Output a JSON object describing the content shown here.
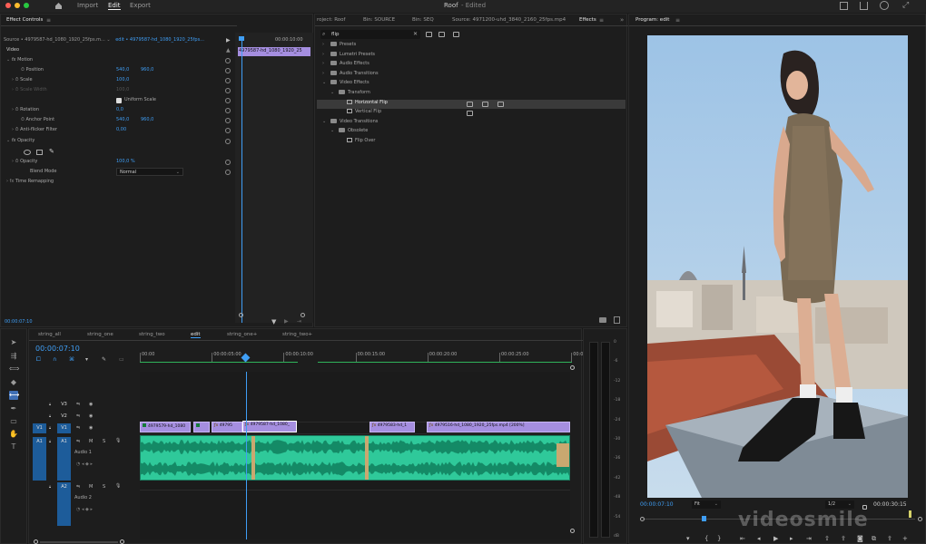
{
  "window": {
    "title": "Roof",
    "subtitle": "- Edited",
    "menu": [
      "Import",
      "Edit",
      "Export"
    ],
    "active_menu": "Edit"
  },
  "effect_controls": {
    "tab": "Effect Controls",
    "source": "Source • 4979587-hd_1080_1920_25fps.m...",
    "sequence": "edit • 4979587-hd_1080_1920_25fps...",
    "time_ruler": "00:00:10:00",
    "clip_label": "4979587-hd_1080_1920_25",
    "video_header": "Video",
    "motion": "Motion",
    "position_label": "Position",
    "position_x": "540,0",
    "position_y": "960,0",
    "scale_label": "Scale",
    "scale_value": "100,0",
    "scale_width_label": "Scale Width",
    "scale_width_value": "100,0",
    "uniform_scale": "Uniform Scale",
    "rotation_label": "Rotation",
    "rotation_value": "0,0",
    "anchor_label": "Anchor Point",
    "anchor_x": "540,0",
    "anchor_y": "960,0",
    "antiflicker_label": "Anti-flicker Filter",
    "antiflicker_value": "0,00",
    "opacity": "Opacity",
    "opacity_label": "Opacity",
    "opacity_value": "100,0 %",
    "blend_label": "Blend Mode",
    "blend_value": "Normal",
    "time_remap": "Time Remapping",
    "timecode": "00:00:07:10"
  },
  "effects_panel": {
    "tabs": [
      "roject: Roof",
      "Bin: SOURCE",
      "Bin: SEQ",
      "Source: 4971200-uhd_3840_2160_25fps.mp4",
      "Effects"
    ],
    "search": "flip",
    "tree": [
      {
        "label": "Presets",
        "indent": 0,
        "type": "folder"
      },
      {
        "label": "Lumetri Presets",
        "indent": 0,
        "type": "folder"
      },
      {
        "label": "Audio Effects",
        "indent": 0,
        "type": "folder"
      },
      {
        "label": "Audio Transitions",
        "indent": 0,
        "type": "folder"
      },
      {
        "label": "Video Effects",
        "indent": 0,
        "type": "folder",
        "open": true
      },
      {
        "label": "Transform",
        "indent": 1,
        "type": "folder",
        "open": true
      },
      {
        "label": "Horizontal Flip",
        "indent": 2,
        "type": "effect",
        "selected": true,
        "badges": 3
      },
      {
        "label": "Vertical Flip",
        "indent": 2,
        "type": "effect",
        "badges": 1
      },
      {
        "label": "Video Transitions",
        "indent": 0,
        "type": "folder",
        "open": true
      },
      {
        "label": "Obsolete",
        "indent": 1,
        "type": "folder",
        "open": true
      },
      {
        "label": "Flip Over",
        "indent": 2,
        "type": "transition"
      }
    ]
  },
  "program_monitor": {
    "title": "Program: edit",
    "timecode": "00:00:07:10",
    "fit": "Fit",
    "resolution": "1/2",
    "duration": "00:00:30:15",
    "watermark": "videosmile"
  },
  "timeline": {
    "tabs": [
      "string_all",
      "string_one",
      "string_two",
      "edit",
      "string_one+",
      "string_two+"
    ],
    "active_tab": "edit",
    "timecode": "00:00:07:10",
    "ruler": [
      "00:00",
      "00:00:05:00",
      "00:00:10:00",
      "00:00:15:00",
      "00:00:20:00",
      "00:00:25:00",
      "00:00"
    ],
    "video_tracks": [
      "V3",
      "V2",
      "V1"
    ],
    "audio_tracks": [
      "A1",
      "A2"
    ],
    "audio1_name": "Audio 1",
    "audio2_name": "Audio 2",
    "clips": [
      {
        "label": "4979579-hd_1080"
      },
      {
        "label": "49795"
      },
      {
        "label": "4979587-hd_1080_"
      },
      {
        "label": "4979583-hd_1"
      },
      {
        "label": "4979516-hd_1080_1920_25fps.mp4 [200%]"
      }
    ]
  },
  "meter": {
    "labels": [
      "0",
      "-6",
      "-12",
      "-18",
      "-24",
      "-30",
      "-36",
      "-42",
      "-48",
      "-54",
      "dB"
    ]
  }
}
